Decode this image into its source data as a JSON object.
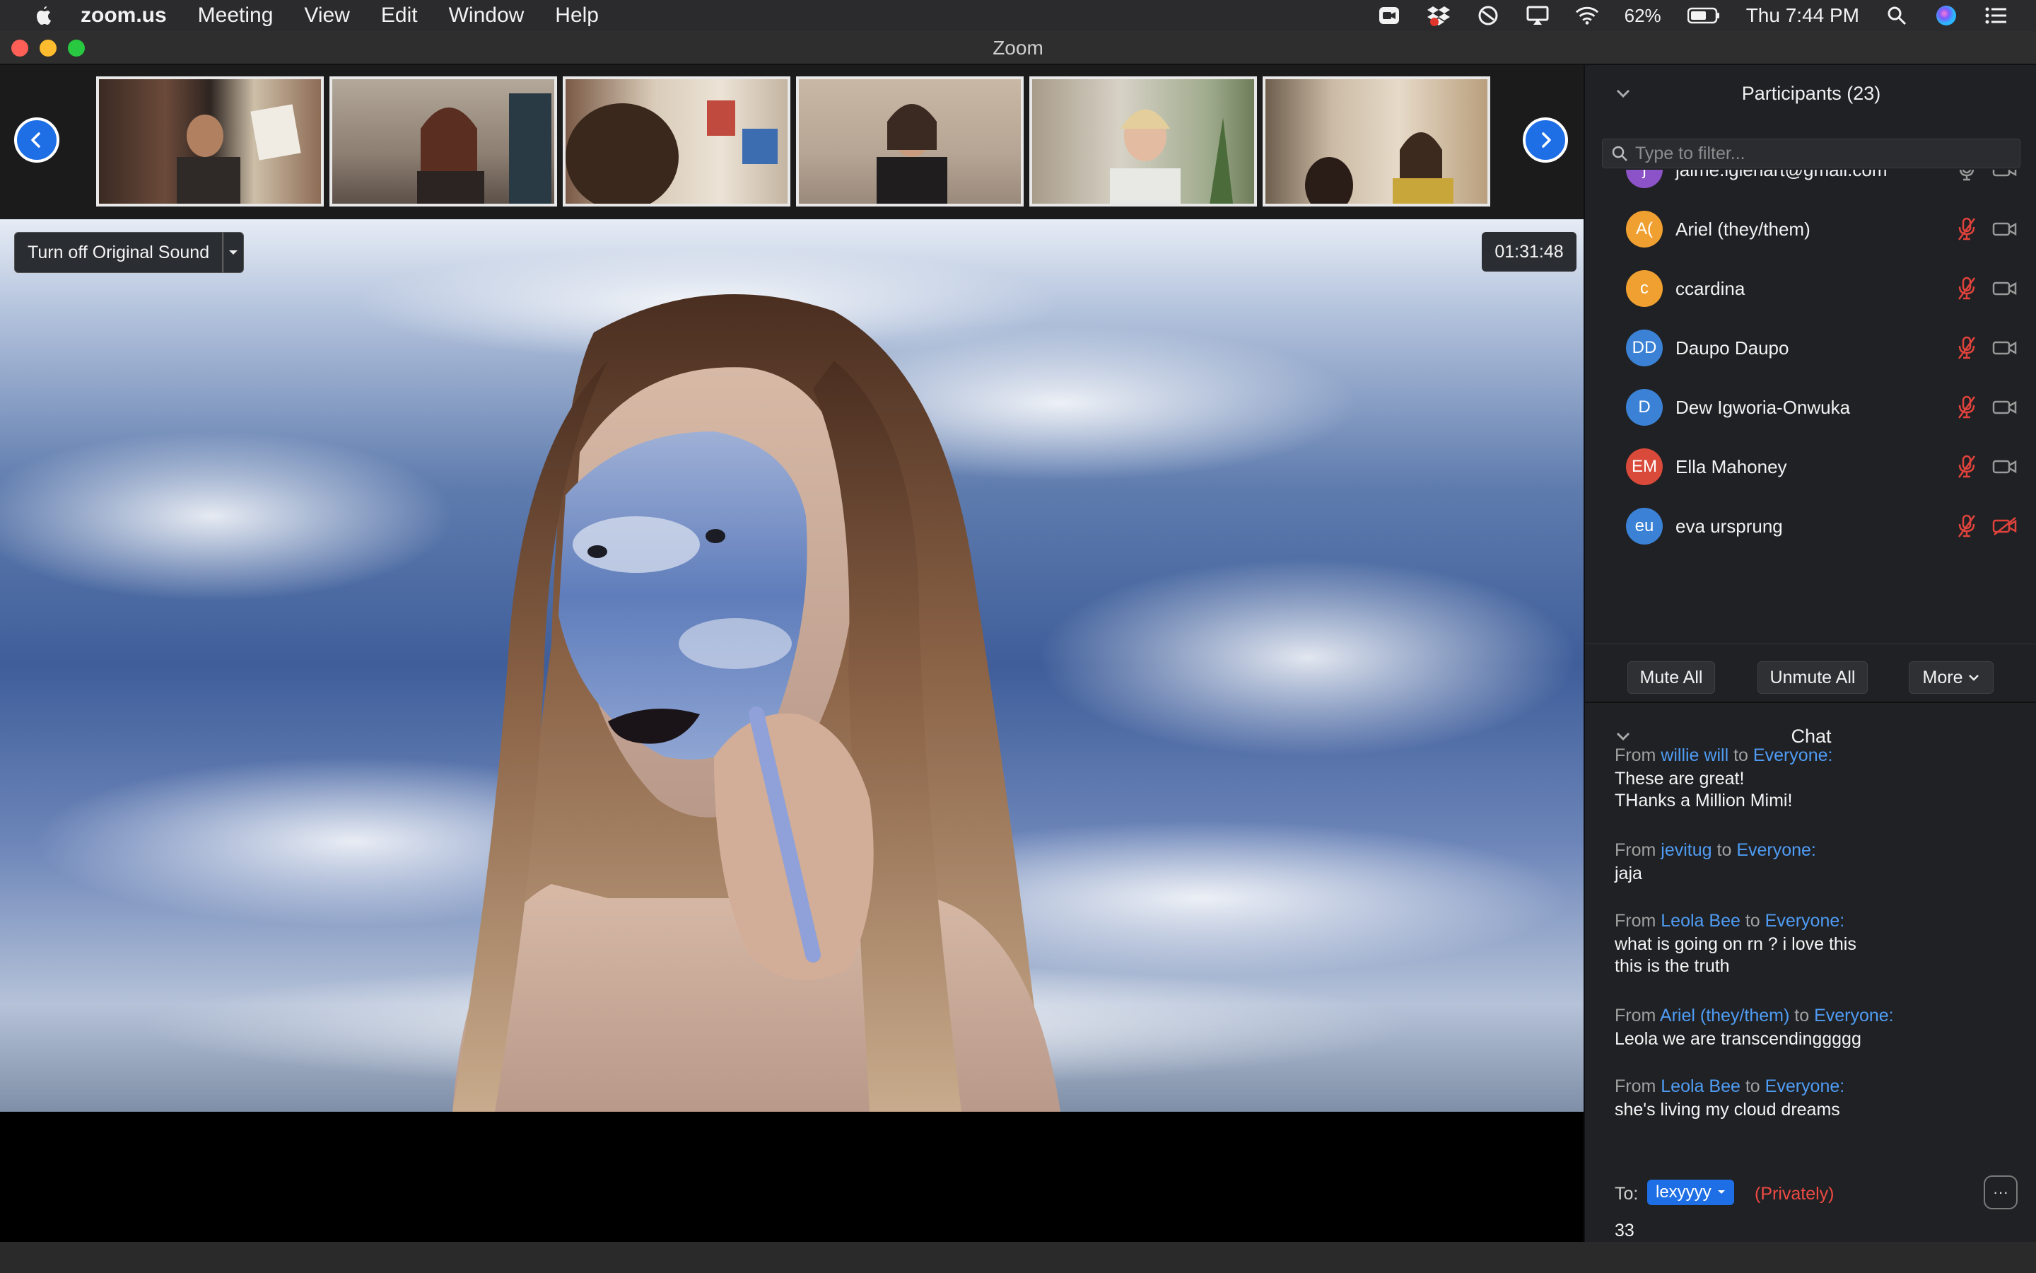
{
  "menubar": {
    "app_name": "zoom.us",
    "menus": [
      "Meeting",
      "View",
      "Edit",
      "Window",
      "Help"
    ],
    "battery": "62%",
    "clock": "Thu 7:44 PM"
  },
  "window": {
    "title": "Zoom"
  },
  "meeting": {
    "original_sound_label": "Turn off Original Sound",
    "timer": "01:31:48",
    "thumbnail_count": 6
  },
  "participants": {
    "header": "Participants (23)",
    "filter_placeholder": "Type to filter...",
    "list": [
      {
        "initials": "j",
        "name": "jaime.iglehart@gmail.com",
        "color": "#8c52c7",
        "muted": false,
        "video_off": false
      },
      {
        "initials": "A(",
        "name": "Ariel (they/them)",
        "color": "#f0a030",
        "muted": true,
        "video_off": false
      },
      {
        "initials": "c",
        "name": "ccardina",
        "color": "#f0a030",
        "muted": true,
        "video_off": false
      },
      {
        "initials": "DD",
        "name": "Daupo Daupo",
        "color": "#3b82d6",
        "muted": true,
        "video_off": false
      },
      {
        "initials": "D",
        "name": "Dew Igworia-Onwuka",
        "color": "#3b82d6",
        "muted": true,
        "video_off": false
      },
      {
        "initials": "EM",
        "name": "Ella Mahoney",
        "color": "#d94a3a",
        "muted": true,
        "video_off": false
      },
      {
        "initials": "eu",
        "name": "eva ursprung",
        "color": "#3b82d6",
        "muted": true,
        "video_off": true
      }
    ],
    "buttons": {
      "mute_all": "Mute All",
      "unmute_all": "Unmute All",
      "more": "More"
    }
  },
  "chat": {
    "header": "Chat",
    "messages": [
      {
        "from_label": "From",
        "sender": "willie will",
        "to_label": "to",
        "recipient": "Everyone:",
        "lines": [
          "These are great!",
          "THanks a Million Mimi!"
        ]
      },
      {
        "from_label": "From",
        "sender": "jevitug",
        "to_label": "to",
        "recipient": "Everyone:",
        "lines": [
          "jaja"
        ]
      },
      {
        "from_label": "From",
        "sender": "Leola Bee",
        "to_label": "to",
        "recipient": "Everyone:",
        "lines": [
          "what is going on rn ? i love this",
          "this is the truth"
        ]
      },
      {
        "from_label": "From",
        "sender": "Ariel (they/them)",
        "to_label": "to",
        "recipient": "Everyone:",
        "lines": [
          "Leola we are transcendinggggg"
        ]
      },
      {
        "from_label": "From",
        "sender": "Leola Bee",
        "to_label": "to",
        "recipient": "Everyone:",
        "lines": [
          "she's living my cloud dreams"
        ]
      }
    ],
    "to_label": "To:",
    "to_recipient": "lexyyyy",
    "privately": "(Privately)",
    "input_value": "33",
    "more_label": "···"
  },
  "colors": {
    "accent": "#1e6fe6",
    "link_name": "#4f9cf4",
    "muted_red": "#ef4a44"
  }
}
